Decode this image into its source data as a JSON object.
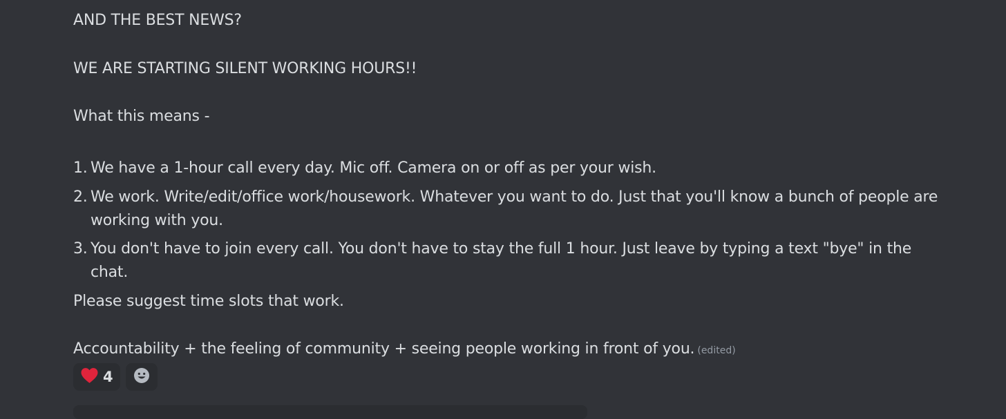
{
  "message": {
    "line1": "AND THE BEST NEWS?",
    "line2": "WE ARE STARTING SILENT WORKING HOURS!!",
    "line3": "What this means -",
    "list": [
      {
        "num": "1.",
        "text": "We have a 1-hour call every day. Mic off. Camera on or off as per your wish."
      },
      {
        "num": "2.",
        "text": "We work. Write/edit/office work/housework. Whatever you want to do. Just that you'll know a bunch of people are working with you."
      },
      {
        "num": "3.",
        "text": "You don't have to join every call. You don't have to stay the full 1 hour. Just leave by typing a text \"bye\" in the chat."
      }
    ],
    "line4": "Please suggest time slots that work.",
    "line5": "Accountability + the feeling of community + seeing people working in front of you.",
    "edited_label": "(edited)"
  },
  "reactions": {
    "heart_count": "4",
    "heart_icon": "red-heart-icon",
    "add_icon": "add-reaction-smile-icon"
  },
  "colors": {
    "background": "#313338",
    "text": "#dbdee1",
    "muted": "#949ba4",
    "reaction_bg": "#2b2d31",
    "heart": "#e0243c"
  }
}
